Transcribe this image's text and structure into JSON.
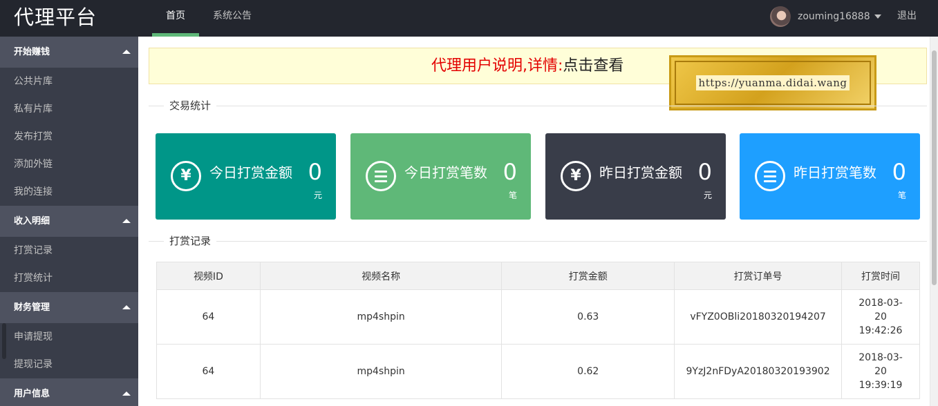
{
  "header": {
    "logo": "代理平台",
    "nav": [
      {
        "label": "首页",
        "active": true
      },
      {
        "label": "系统公告",
        "active": false
      }
    ],
    "username": "zouming16888",
    "logout_label": "退出"
  },
  "sidebar": {
    "groups": [
      {
        "title": "开始赚钱",
        "items": [
          "公共片库",
          "私有片库",
          "发布打赏",
          "添加外链",
          "我的连接"
        ]
      },
      {
        "title": "收入明细",
        "items": [
          "打赏记录",
          "打赏统计"
        ]
      },
      {
        "title": "财务管理",
        "items": [
          "申请提现",
          "提现记录"
        ]
      },
      {
        "title": "用户信息",
        "items": []
      }
    ]
  },
  "notice": {
    "text": "代理用户说明,详情:",
    "link_label": "点击查看"
  },
  "watermark": {
    "text": "https://yuanma.didai.wang"
  },
  "stats_section_title": "交易统计",
  "stats": [
    {
      "label": "今日打赏金额",
      "value": "0",
      "unit": "元",
      "icon": "yen-icon",
      "color": "#009688"
    },
    {
      "label": "今日打赏笔数",
      "value": "0",
      "unit": "笔",
      "icon": "list-icon",
      "color": "#5fb878"
    },
    {
      "label": "昨日打赏金额",
      "value": "0",
      "unit": "元",
      "icon": "yen-icon",
      "color": "#393d49"
    },
    {
      "label": "昨日打赏笔数",
      "value": "0",
      "unit": "笔",
      "icon": "list-icon",
      "color": "#1e9fff"
    }
  ],
  "records_section_title": "打赏记录",
  "table": {
    "headers": [
      "视频ID",
      "视频名称",
      "打赏金额",
      "打赏订单号",
      "打赏时间"
    ],
    "rows": [
      {
        "video_id": "64",
        "video_name": "mp4shpin",
        "amount": "0.63",
        "order_no": "vFYZ0OBli20180320194207",
        "time_date": "2018-03-",
        "time_day": "20",
        "time_clock": "19:42:26"
      },
      {
        "video_id": "64",
        "video_name": "mp4shpin",
        "amount": "0.62",
        "order_no": "9YzJ2nFDyA20180320193902",
        "time_date": "2018-03-",
        "time_day": "20",
        "time_clock": "19:39:19"
      }
    ]
  }
}
